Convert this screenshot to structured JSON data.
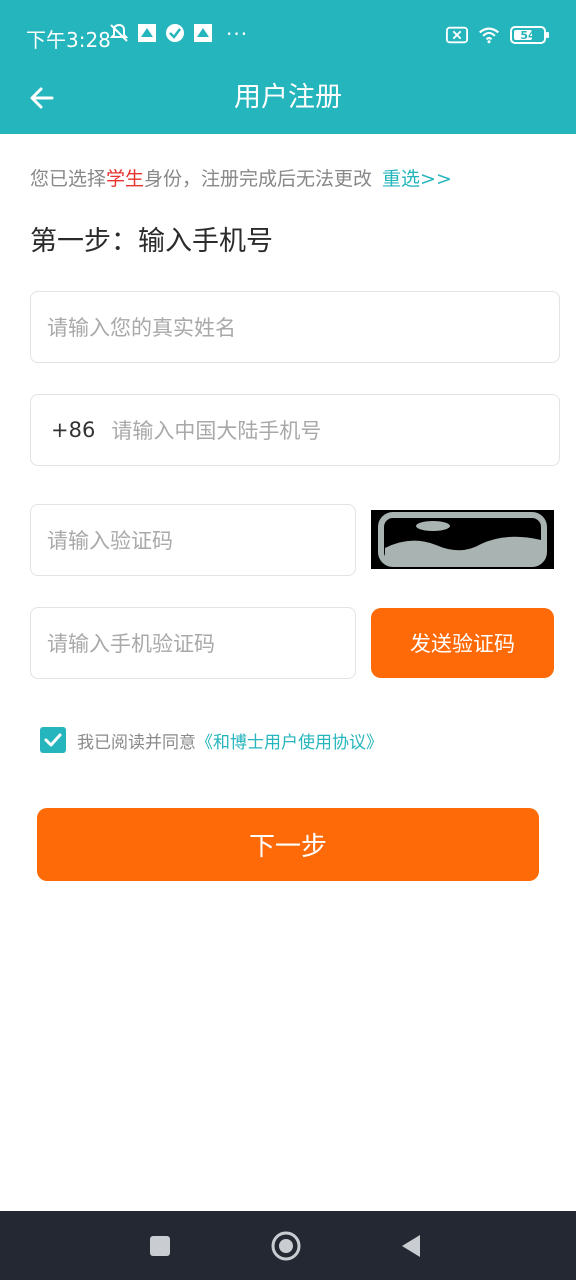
{
  "status_bar": {
    "time": "下午3:28",
    "dots": "···",
    "battery": "54"
  },
  "header": {
    "title": "用户注册"
  },
  "notice": {
    "prefix": "您已选择",
    "role": "学生",
    "suffix": "身份，注册完成后无法更改",
    "reselect": "重选>>"
  },
  "step": {
    "title": "第一步：输入手机号"
  },
  "form": {
    "name_placeholder": "请输入您的真实姓名",
    "phone_prefix": "+86",
    "phone_placeholder": "请输入中国大陆手机号",
    "captcha_placeholder": "请输入验证码",
    "sms_placeholder": "请输入手机验证码",
    "send_code_label": "发送验证码"
  },
  "agreement": {
    "checked": true,
    "text": "我已阅读并同意",
    "link": "《和博士用户使用协议》"
  },
  "next_button": "下一步",
  "colors": {
    "teal": "#25b5bc",
    "orange": "#ff6a08",
    "highlight_red": "#e8332f"
  }
}
